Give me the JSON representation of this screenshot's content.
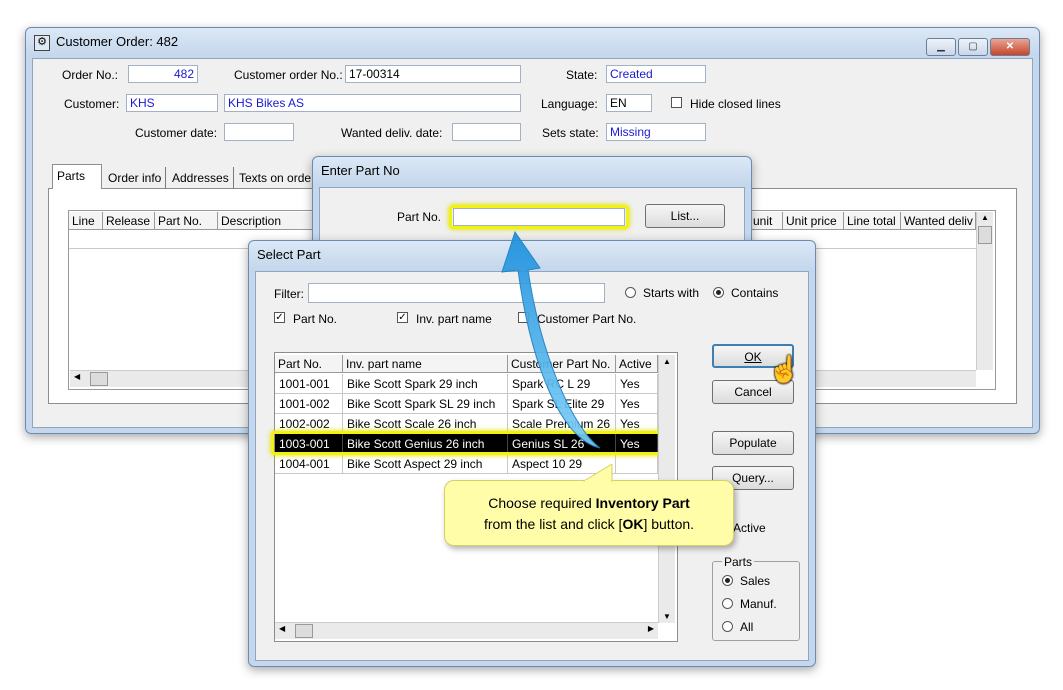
{
  "main": {
    "title": "Customer Order: 482",
    "order_no_label": "Order No.:",
    "order_no": "482",
    "cust_order_no_label": "Customer order No.:",
    "cust_order_no": "17-00314",
    "state_label": "State:",
    "state": "Created",
    "customer_label": "Customer:",
    "customer_code": "KHS",
    "customer_name": "KHS Bikes AS",
    "language_label": "Language:",
    "language": "EN",
    "hide_closed_label": "Hide closed lines",
    "customer_date_label": "Customer date:",
    "wanted_date_label": "Wanted deliv. date:",
    "sets_state_label": "Sets state:",
    "sets_state": "Missing",
    "tabs": [
      "Parts",
      "Order info",
      "Addresses",
      "Texts on orde"
    ],
    "grid_headers_left": [
      "Line",
      "Release",
      "Part No.",
      "Description"
    ],
    "grid_headers_right": [
      "unit",
      "Unit price",
      "Line total",
      "Wanted deliv"
    ]
  },
  "enter_part": {
    "title": "Enter Part No",
    "part_no_label": "Part No.",
    "list_button": "List..."
  },
  "select_part": {
    "title": "Select Part",
    "filter_label": "Filter:",
    "starts_with_label": "Starts with",
    "contains_label": "Contains",
    "chk_part_no": "Part No.",
    "chk_inv_name": "Inv. part name",
    "chk_cust_part": "Customer Part No.",
    "columns": [
      "Part No.",
      "Inv. part name",
      "Customer Part No.",
      "Active"
    ],
    "rows": [
      [
        "1001-001",
        "Bike Scott Spark 29 inch",
        "Spark RC L 29",
        "Yes"
      ],
      [
        "1001-002",
        "Bike Scott Spark SL 29 inch",
        "Spark SL Elite 29",
        "Yes"
      ],
      [
        "1002-002",
        "Bike Scott Scale 26 inch",
        "Scale Premium 26",
        "Yes"
      ],
      [
        "1003-001",
        "Bike Scott Genius 26 inch",
        "Genius SL 26",
        "Yes"
      ],
      [
        "1004-001",
        "Bike Scott Aspect 29 inch",
        "Aspect 10 29",
        ""
      ]
    ],
    "selected_row": 3,
    "ok_button": "OK",
    "cancel_button": "Cancel",
    "populate_button": "Populate",
    "query_button": "Query...",
    "active_label": "Active",
    "parts_group_label": "Parts",
    "parts_options": [
      "Sales",
      "Manuf.",
      "All"
    ]
  },
  "callout": {
    "line1_pre": "Choose required ",
    "line1_bold": "Inventory Part",
    "line2_pre": "from the list and click [",
    "line2_bold": "OK",
    "line2_post": "] button."
  },
  "colors": {
    "highlight": "#f2f20a",
    "arrow": "#2ea6e8",
    "callout_bg": "#fffda8",
    "field_text_blue": "#1a1ad2"
  }
}
